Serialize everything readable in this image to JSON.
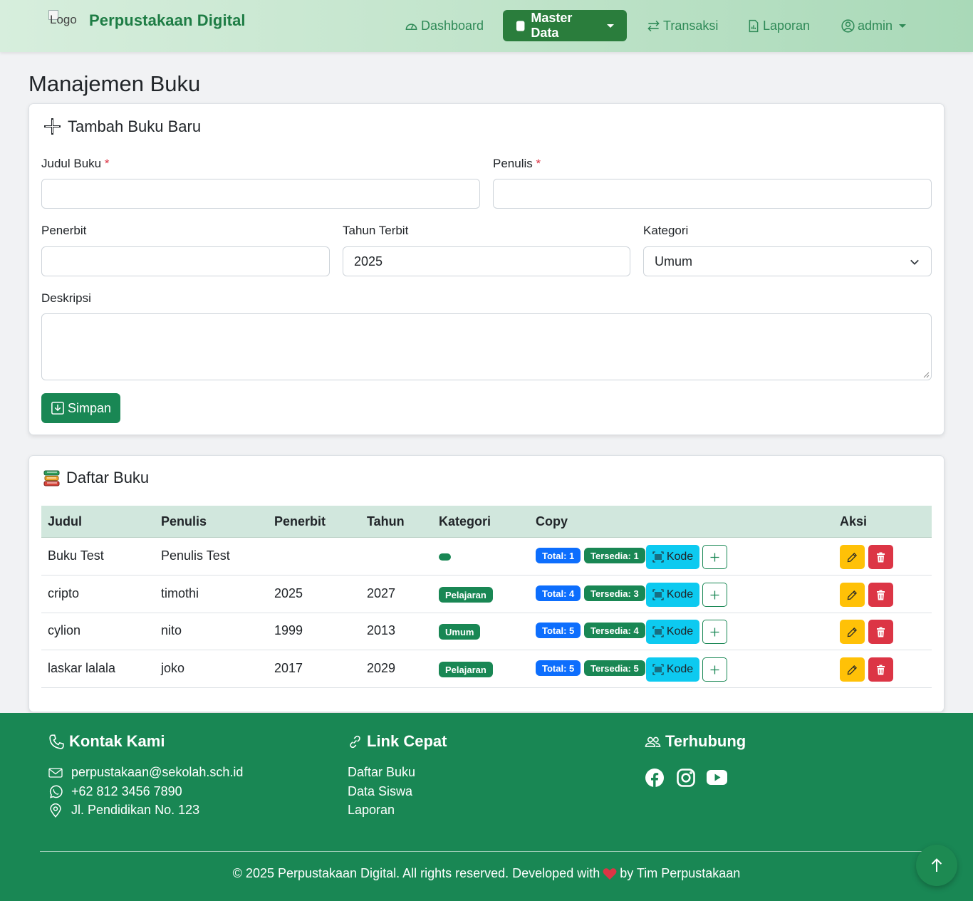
{
  "navbar": {
    "logo_alt": "Logo",
    "brand": "Perpustakaan Digital",
    "items": [
      {
        "label": "Dashboard",
        "icon": "speedometer-icon"
      },
      {
        "label": "Master Data",
        "icon": "database-icon",
        "active": true
      },
      {
        "label": "Transaksi",
        "icon": "arrow-left-right-icon"
      },
      {
        "label": "Laporan",
        "icon": "file-chart-icon"
      }
    ],
    "user": "admin"
  },
  "page": {
    "title": "Manajemen Buku"
  },
  "form": {
    "title": "Tambah Buku Baru",
    "judul": {
      "label": "Judul Buku",
      "required": "*",
      "value": ""
    },
    "penulis": {
      "label": "Penulis",
      "required": "*",
      "value": ""
    },
    "penerbit": {
      "label": "Penerbit",
      "value": ""
    },
    "tahun": {
      "label": "Tahun Terbit",
      "value": "2025"
    },
    "kategori": {
      "label": "Kategori",
      "value": "Umum"
    },
    "deskripsi": {
      "label": "Deskripsi",
      "value": ""
    },
    "save_label": "Simpan"
  },
  "list": {
    "title": "Daftar Buku",
    "columns": [
      "Judul",
      "Penulis",
      "Penerbit",
      "Tahun",
      "Kategori",
      "Copy",
      "Aksi"
    ],
    "kode_label": "Kode",
    "rows": [
      {
        "judul": "Buku Test",
        "penulis": "Penulis Test",
        "penerbit": "",
        "tahun": "",
        "kategori": "",
        "total": "Total: 1",
        "tersedia": "Tersedia: 1"
      },
      {
        "judul": "cripto",
        "penulis": "timothi",
        "penerbit": "2025",
        "tahun": "2027",
        "kategori": "Pelajaran",
        "total": "Total: 4",
        "tersedia": "Tersedia: 3"
      },
      {
        "judul": "cylion",
        "penulis": "nito",
        "penerbit": "1999",
        "tahun": "2013",
        "kategori": "Umum",
        "total": "Total: 5",
        "tersedia": "Tersedia: 4"
      },
      {
        "judul": "laskar lalala",
        "penulis": "joko",
        "penerbit": "2017",
        "tahun": "2029",
        "kategori": "Pelajaran",
        "total": "Total: 5",
        "tersedia": "Tersedia: 5"
      }
    ]
  },
  "footer": {
    "kontak": {
      "title": "Kontak Kami",
      "email": "perpustakaan@sekolah.sch.id",
      "phone": "+62 812 3456 7890",
      "address": "Jl. Pendidikan No. 123"
    },
    "links": {
      "title": "Link Cepat",
      "items": [
        "Daftar Buku",
        "Data Siswa",
        "Laporan"
      ]
    },
    "connect": {
      "title": "Terhubung"
    },
    "copyright_pre": "© 2025 Perpustakaan Digital. All rights reserved. Developed with",
    "copyright_post": "by Tim Perpustakaan"
  },
  "colors": {
    "primary": "#198754",
    "nav_active": "#2a7d3c",
    "brand_text": "#1e7d45",
    "badge_total": "#0d6efd",
    "badge_tersedia": "#198754",
    "kode_button": "#0dcaf0",
    "edit_button": "#ffc107",
    "delete_button": "#dc3545"
  }
}
